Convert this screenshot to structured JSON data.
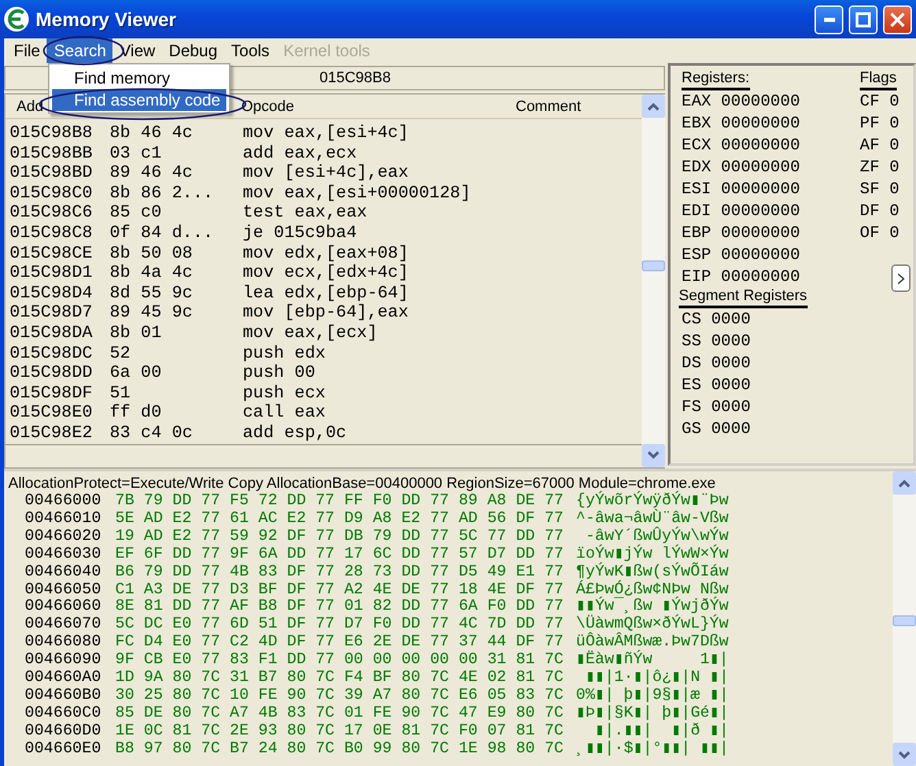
{
  "window": {
    "title": "Memory Viewer"
  },
  "menu": [
    {
      "label": "File",
      "selected": false,
      "disabled": false
    },
    {
      "label": "Search",
      "selected": true,
      "disabled": false
    },
    {
      "label": "View",
      "selected": false,
      "disabled": false
    },
    {
      "label": "Debug",
      "selected": false,
      "disabled": false
    },
    {
      "label": "Tools",
      "selected": false,
      "disabled": false
    },
    {
      "label": "Kernel tools",
      "selected": false,
      "disabled": true
    }
  ],
  "open_menu": {
    "items": [
      {
        "label": "Find memory",
        "selected": false
      },
      {
        "label": "Find assembly code",
        "selected": true
      }
    ]
  },
  "disassembler": {
    "address": "015C98B8",
    "columns": [
      "Add",
      "Opcode",
      "Comment"
    ],
    "rows": [
      {
        "address": "015C98B8",
        "bytes": "8b 46 4c",
        "opcode": "mov eax,[esi+4c]"
      },
      {
        "address": "015C98BB",
        "bytes": "03 c1",
        "opcode": "add eax,ecx"
      },
      {
        "address": "015C98BD",
        "bytes": "89 46 4c",
        "opcode": "mov [esi+4c],eax"
      },
      {
        "address": "015C98C0",
        "bytes": "8b 86 2...",
        "opcode": "mov eax,[esi+00000128]"
      },
      {
        "address": "015C98C6",
        "bytes": "85 c0",
        "opcode": "test eax,eax"
      },
      {
        "address": "015C98C8",
        "bytes": "0f 84 d...",
        "opcode": "je 015c9ba4"
      },
      {
        "address": "015C98CE",
        "bytes": "8b 50 08",
        "opcode": "mov edx,[eax+08]"
      },
      {
        "address": "015C98D1",
        "bytes": "8b 4a 4c",
        "opcode": "mov ecx,[edx+4c]"
      },
      {
        "address": "015C98D4",
        "bytes": "8d 55 9c",
        "opcode": "lea edx,[ebp-64]"
      },
      {
        "address": "015C98D7",
        "bytes": "89 45 9c",
        "opcode": "mov [ebp-64],eax"
      },
      {
        "address": "015C98DA",
        "bytes": "8b 01",
        "opcode": "mov eax,[ecx]"
      },
      {
        "address": "015C98DC",
        "bytes": "52",
        "opcode": "push edx"
      },
      {
        "address": "015C98DD",
        "bytes": "6a 00",
        "opcode": "push 00"
      },
      {
        "address": "015C98DF",
        "bytes": "51",
        "opcode": "push ecx"
      },
      {
        "address": "015C98E0",
        "bytes": "ff d0",
        "opcode": "call eax"
      },
      {
        "address": "015C98E2",
        "bytes": "83 c4 0c",
        "opcode": "add esp,0c"
      }
    ]
  },
  "registers": {
    "title": "Registers:",
    "items": [
      {
        "name": "EAX",
        "value": "00000000"
      },
      {
        "name": "EBX",
        "value": "00000000"
      },
      {
        "name": "ECX",
        "value": "00000000"
      },
      {
        "name": "EDX",
        "value": "00000000"
      },
      {
        "name": "ESI",
        "value": "00000000"
      },
      {
        "name": "EDI",
        "value": "00000000"
      },
      {
        "name": "EBP",
        "value": "00000000"
      },
      {
        "name": "ESP",
        "value": "00000000"
      },
      {
        "name": "EIP",
        "value": "00000000"
      }
    ]
  },
  "flags": {
    "title": "Flags",
    "items": [
      {
        "name": "CF",
        "value": "0"
      },
      {
        "name": "PF",
        "value": "0"
      },
      {
        "name": "AF",
        "value": "0"
      },
      {
        "name": "ZF",
        "value": "0"
      },
      {
        "name": "SF",
        "value": "0"
      },
      {
        "name": "DF",
        "value": "0"
      },
      {
        "name": "OF",
        "value": "0"
      }
    ]
  },
  "segment_registers": {
    "title": "Segment Registers",
    "items": [
      {
        "name": "CS",
        "value": "0000"
      },
      {
        "name": "SS",
        "value": "0000"
      },
      {
        "name": "DS",
        "value": "0000"
      },
      {
        "name": "ES",
        "value": "0000"
      },
      {
        "name": "FS",
        "value": "0000"
      },
      {
        "name": "GS",
        "value": "0000"
      }
    ]
  },
  "hex_view": {
    "info": "AllocationProtect=Execute/Write Copy  AllocationBase=00400000 RegionSize=67000 Module=chrome.exe",
    "rows": [
      {
        "address": "00466000",
        "bytes": "7B 79 DD 77 F5 72 DD 77 FF F0 DD 77 89 A8 DE 77",
        "ascii": "{yÝwõrÝwÿðÝw▮¨Þw"
      },
      {
        "address": "00466010",
        "bytes": "5E AD E2 77 61 AC E2 77 D9 A8 E2 77 AD 56 DF 77",
        "ascii": "^-âwa¬âwÙ¨âw-Vßw"
      },
      {
        "address": "00466020",
        "bytes": "19 AD E2 77 59 92 DF 77 DB 79 DD 77 5C 77 DD 77",
        "ascii": " -âwY´ßwÛyÝw\\wÝw"
      },
      {
        "address": "00466030",
        "bytes": "EF 6F DD 77 9F 6A DD 77 17 6C DD 77 57 D7 DD 77",
        "ascii": "ïoÝw▮jÝw lÝwW×Ýw"
      },
      {
        "address": "00466040",
        "bytes": "B6 79 DD 77 4B 83 DF 77 28 73 DD 77 D5 49 E1 77",
        "ascii": "¶yÝwK▮ßw(sÝwÕIáw"
      },
      {
        "address": "00466050",
        "bytes": "C1 A3 DE 77 D3 BF DF 77 A2 4E DE 77 18 4E DF 77",
        "ascii": "Á£ÞwÓ¿ßw¢NÞw Nßw"
      },
      {
        "address": "00466060",
        "bytes": "8E 81 DD 77 AF B8 DF 77 01 82 DD 77 6A F0 DD 77",
        "ascii": "▮▮Ýw¯¸ßw ▮ÝwjðÝw"
      },
      {
        "address": "00466070",
        "bytes": "5C DC E0 77 6D 51 DF 77 D7 F0 DD 77 4C 7D DD 77",
        "ascii": "\\ÜàwmQßw×ðÝwL}Ýw"
      },
      {
        "address": "00466080",
        "bytes": "FC D4 E0 77 C2 4D DF 77 E6 2E DE 77 37 44 DF 77",
        "ascii": "üÔàwÂMßwæ.Þw7Dßw"
      },
      {
        "address": "00466090",
        "bytes": "9F CB E0 77 83 F1 DD 77 00 00 00 00 00 31 81 7C",
        "ascii": "▮Ëàw▮ñÝw     1▮|"
      },
      {
        "address": "004660A0",
        "bytes": "1D 9A 80 7C 31 B7 80 7C F4 BF 80 7C 4E 02 81 7C",
        "ascii": " ▮▮|1·▮|ô¿▮|N ▮|"
      },
      {
        "address": "004660B0",
        "bytes": "30 25 80 7C 10 FE 90 7C 39 A7 80 7C E6 05 83 7C",
        "ascii": "0%▮| þ▮|9§▮|æ ▮|"
      },
      {
        "address": "004660C0",
        "bytes": "85 DE 80 7C A7 4B 83 7C 01 FE 90 7C 47 E9 80 7C",
        "ascii": "▮Þ▮|§K▮| þ▮|Gé▮|"
      },
      {
        "address": "004660D0",
        "bytes": "1E 0C 81 7C 2E 93 80 7C 17 0E 81 7C F0 07 81 7C",
        "ascii": "  ▮|.▮▮|  ▮|ð ▮|"
      },
      {
        "address": "004660E0",
        "bytes": "B8 97 80 7C B7 24 80 7C B0 99 80 7C 1E 98 80 7C",
        "ascii": "¸▮▮|·$▮|°▮▮| ▮▮|"
      }
    ]
  }
}
